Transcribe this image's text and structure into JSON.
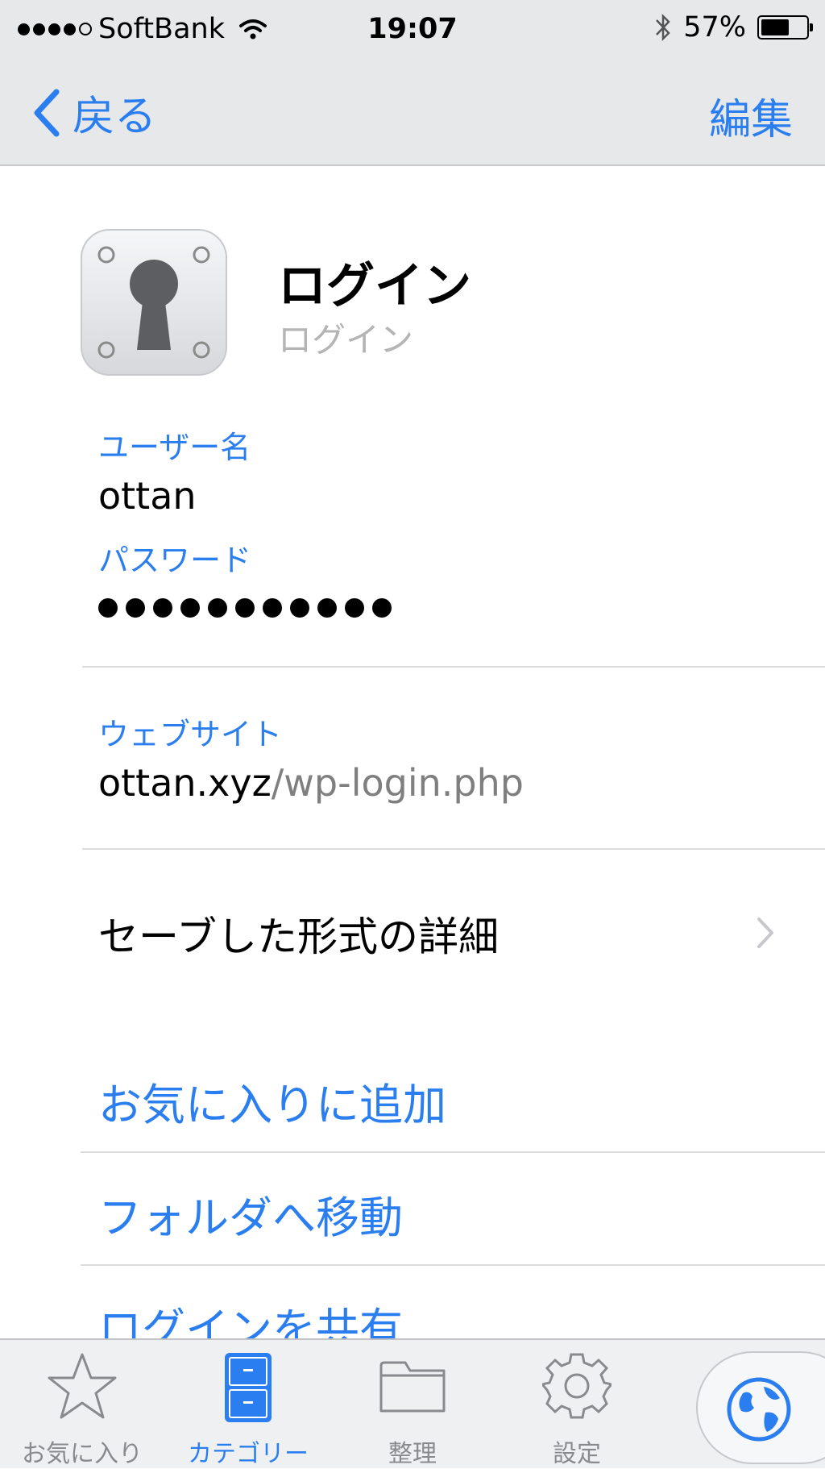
{
  "status_bar": {
    "carrier": "SoftBank",
    "time": "19:07",
    "battery_text": "57%",
    "battery_level": 0.57,
    "signal_bars": 4,
    "signal_max": 5
  },
  "nav": {
    "back_label": "戻る",
    "edit_label": "編集"
  },
  "item": {
    "icon": "keyhole-icon",
    "title": "ログイン",
    "subtitle": "ログイン"
  },
  "fields": {
    "username_label": "ユーザー名",
    "username_value": "ottan",
    "password_label": "パスワード",
    "password_mask": "●●●●●●●●●●●",
    "website_label": "ウェブサイト",
    "website_domain": "ottan.xyz",
    "website_path": "/wp-login.php"
  },
  "detail_row": {
    "label": "セーブした形式の詳細"
  },
  "actions": {
    "add_favorite": "お気に入りに追加",
    "move_folder": "フォルダへ移動",
    "share_login": "ログインを共有"
  },
  "tab_bar": {
    "tabs": [
      {
        "label": "お気に入り",
        "icon": "star-icon"
      },
      {
        "label": "カテゴリー",
        "icon": "cabinet-icon"
      },
      {
        "label": "整理",
        "icon": "folder-icon"
      },
      {
        "label": "設定",
        "icon": "gear-icon"
      }
    ],
    "active_index": 1,
    "globe_icon": "globe-icon"
  },
  "colors": {
    "accent": "#2a7ef0",
    "bar_bg": "#e7e8ea",
    "muted_text": "#7f7f7f"
  }
}
